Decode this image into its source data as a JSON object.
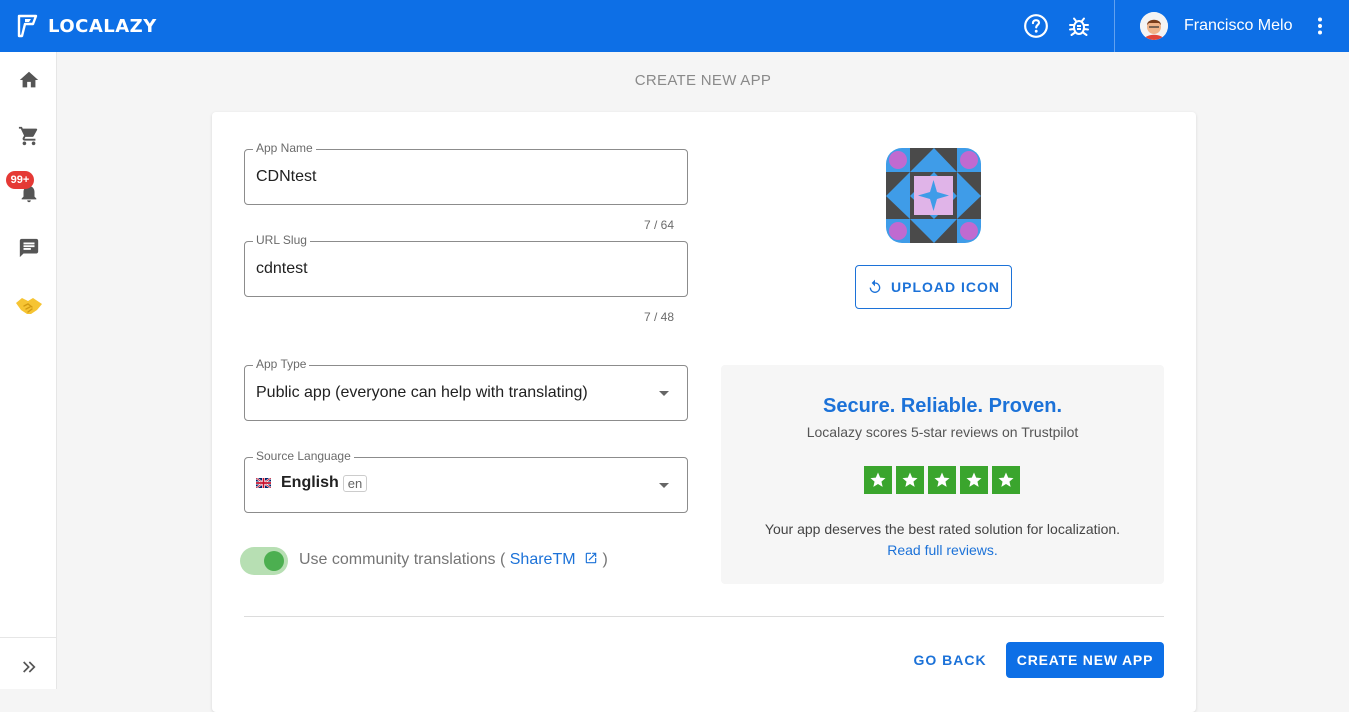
{
  "header": {
    "brand": "LOCALAZY",
    "user_name": "Francisco Melo",
    "icons": [
      "help-icon",
      "bug-icon",
      "more-vert-icon"
    ]
  },
  "sidebar": {
    "items": [
      {
        "icon": "home-icon"
      },
      {
        "icon": "cart-icon"
      },
      {
        "icon": "bell-icon",
        "badge": "99+"
      },
      {
        "icon": "chat-icon"
      },
      {
        "icon": "handshake-icon"
      }
    ],
    "expand_icon": "double-chevron-right-icon"
  },
  "page": {
    "title": "CREATE NEW APP"
  },
  "form": {
    "app_name": {
      "label": "App Name",
      "value": "CDNtest",
      "counter": "7 / 64"
    },
    "url_slug": {
      "label": "URL Slug",
      "value": "cdntest",
      "counter": "7 / 48"
    },
    "app_type": {
      "label": "App Type",
      "value": "Public app (everyone can help with translating)"
    },
    "source_language": {
      "label": "Source Language",
      "value": "English",
      "code": "en"
    },
    "community": {
      "text_before": "Use community translations (",
      "link": "ShareTM",
      "text_after": ")",
      "enabled": true
    }
  },
  "icon_panel": {
    "upload_label": "UPLOAD ICON"
  },
  "trust": {
    "title": "Secure. Reliable. Proven.",
    "subtitle": "Localazy scores 5-star reviews on Trustpilot",
    "rating": 5,
    "description": "Your app deserves the best rated solution for localization.",
    "link": "Read full reviews."
  },
  "actions": {
    "back_label": "GO BACK",
    "create_label": "CREATE NEW APP"
  },
  "colors": {
    "primary": "#0d6fe6",
    "link": "#1c72d8",
    "trustpilot_green": "#3aa52d",
    "badge_red": "#e53935"
  }
}
